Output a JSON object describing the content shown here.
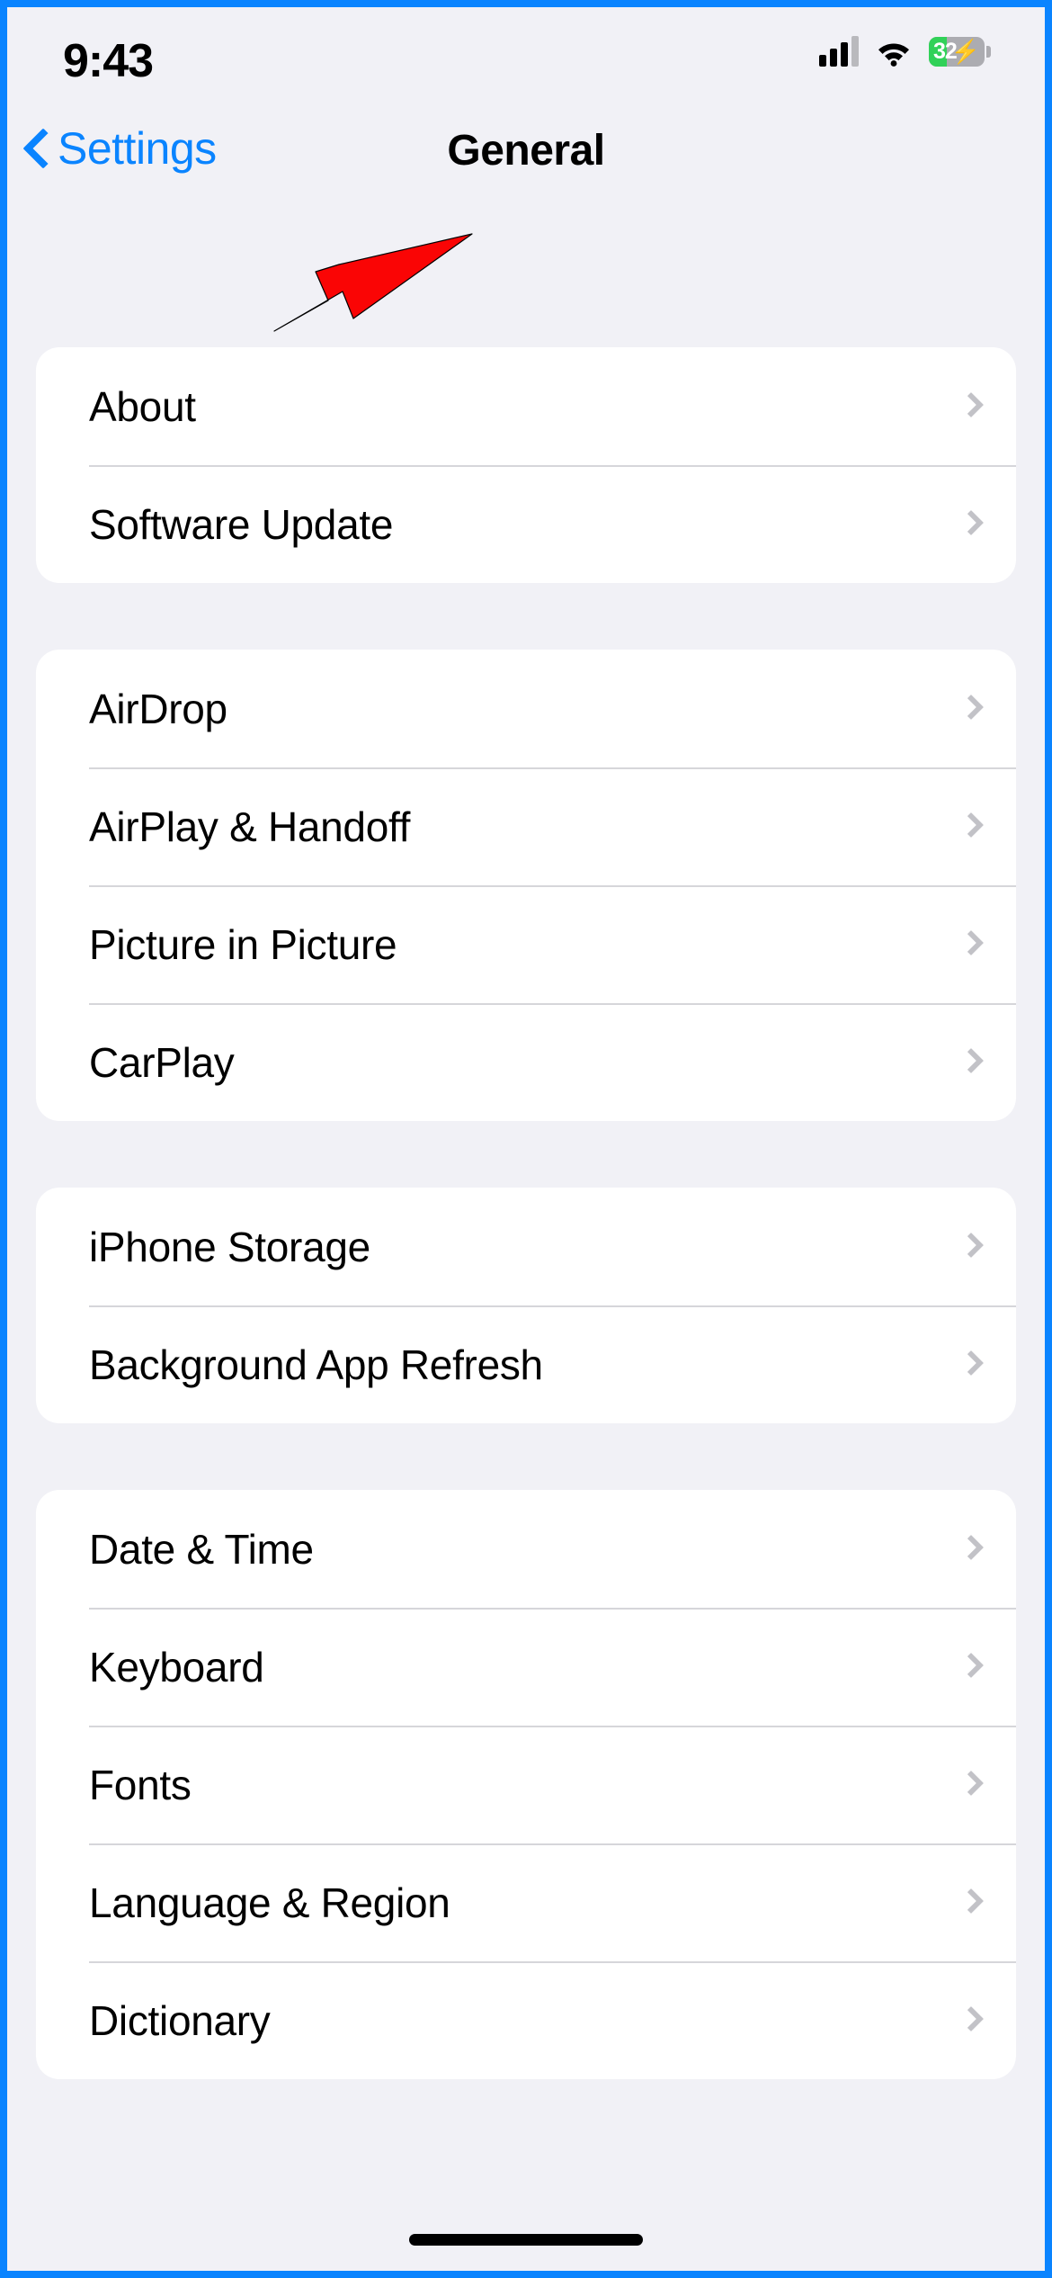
{
  "status_bar": {
    "time": "9:43",
    "signal_icon": "cellular-bars-icon",
    "wifi_icon": "wifi-icon",
    "battery": {
      "level_text": "32",
      "level_percent": 32,
      "charging": true,
      "charging_icon": "lightning-bolt-icon",
      "fill_color": "#31d158",
      "track_color": "#acacb1"
    }
  },
  "nav": {
    "back_label": "Settings",
    "back_icon": "chevron-left-icon",
    "title": "General",
    "accent_color": "#0a84ff"
  },
  "groups": [
    {
      "rows": [
        {
          "label": "About",
          "disclosure_icon": "chevron-right-icon"
        },
        {
          "label": "Software Update",
          "disclosure_icon": "chevron-right-icon"
        }
      ]
    },
    {
      "rows": [
        {
          "label": "AirDrop",
          "disclosure_icon": "chevron-right-icon"
        },
        {
          "label": "AirPlay & Handoff",
          "disclosure_icon": "chevron-right-icon"
        },
        {
          "label": "Picture in Picture",
          "disclosure_icon": "chevron-right-icon"
        },
        {
          "label": "CarPlay",
          "disclosure_icon": "chevron-right-icon"
        }
      ]
    },
    {
      "rows": [
        {
          "label": "iPhone Storage",
          "disclosure_icon": "chevron-right-icon"
        },
        {
          "label": "Background App Refresh",
          "disclosure_icon": "chevron-right-icon"
        }
      ]
    },
    {
      "rows": [
        {
          "label": "Date & Time",
          "disclosure_icon": "chevron-right-icon"
        },
        {
          "label": "Keyboard",
          "disclosure_icon": "chevron-right-icon"
        },
        {
          "label": "Fonts",
          "disclosure_icon": "chevron-right-icon"
        },
        {
          "label": "Language & Region",
          "disclosure_icon": "chevron-right-icon"
        },
        {
          "label": "Dictionary",
          "disclosure_icon": "chevron-right-icon"
        }
      ]
    }
  ],
  "annotation": {
    "icon": "red-arrow-pointing-left",
    "color": "#fa0505",
    "target_row": "Software Update"
  },
  "home_indicator": {
    "present": true
  },
  "frame": {
    "border_color": "#0a84ff"
  }
}
